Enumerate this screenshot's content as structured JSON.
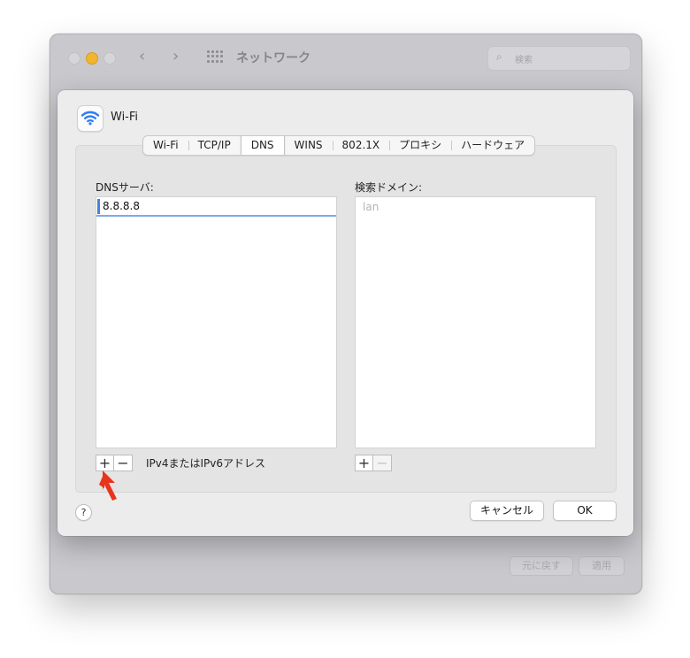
{
  "background_window": {
    "title": "ネットワーク",
    "search_placeholder": "検索",
    "revert_label": "元に戻す",
    "apply_label": "適用"
  },
  "sheet": {
    "service_title": "Wi-Fi",
    "tabs": [
      "Wi-Fi",
      "TCP/IP",
      "DNS",
      "WINS",
      "802.1X",
      "プロキシ",
      "ハードウェア"
    ],
    "active_tab": "DNS",
    "dns_servers": {
      "label": "DNSサーバ:",
      "entries": [
        "8.8.8.8"
      ],
      "hint": "IPv4またはIPv6アドレス"
    },
    "search_domains": {
      "label": "検索ドメイン:",
      "entries": [
        "lan"
      ]
    },
    "add_symbol": "+",
    "remove_symbol": "−",
    "help_symbol": "?",
    "cancel_label": "キャンセル",
    "ok_label": "OK"
  },
  "colors": {
    "accent": "#4a7fdc",
    "annotation_arrow": "#e8341c",
    "traffic_light_yellow": "#f3b52d"
  },
  "icons": [
    "wifi-icon",
    "search-icon",
    "grid-icon",
    "chevron-left-icon",
    "chevron-right-icon",
    "arrow-pointer-icon"
  ]
}
